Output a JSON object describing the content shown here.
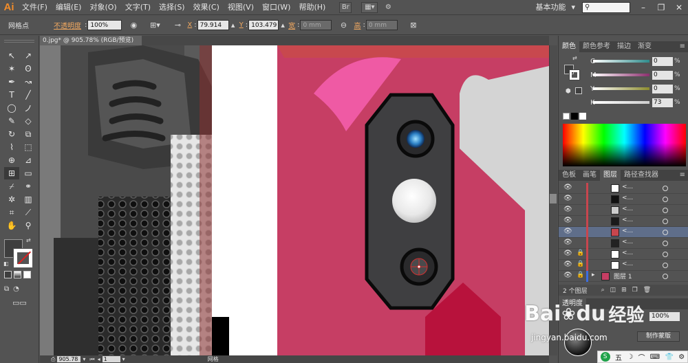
{
  "app": {
    "logo": "Ai"
  },
  "menu": [
    "文件(F)",
    "编辑(E)",
    "对象(O)",
    "文字(T)",
    "选择(S)",
    "效果(C)",
    "视图(V)",
    "窗口(W)",
    "帮助(H)"
  ],
  "menubar_buttons": {
    "bridge": "Br",
    "workspace": "基本功能"
  },
  "control": {
    "selection_label": "网格点",
    "opacity_label": "不透明度",
    "opacity_value": "100%",
    "x_label": "X",
    "x_value": "79.914",
    "y_label": "Y",
    "y_value": "103.479",
    "w_label": "宽",
    "w_value": "0 mm",
    "h_label": "高",
    "h_value": "0 mm"
  },
  "document": {
    "tab_title": "0.jpg* @ 905.78% (RGB/预览)"
  },
  "status": {
    "zoom": "905.78",
    "page": "1",
    "tool": "网格"
  },
  "color_panel": {
    "tabs": [
      "颜色",
      "颜色参考",
      "描边",
      "渐变"
    ],
    "channels": [
      {
        "label": "C",
        "value": "0",
        "color": "#2e8c8c"
      },
      {
        "label": "M",
        "value": "0",
        "color": "#8c2e6e"
      },
      {
        "label": "Y",
        "value": "0",
        "color": "#8c8c2e"
      },
      {
        "label": "K",
        "value": "73",
        "color": "#cfcfcf"
      }
    ],
    "percent": "%"
  },
  "layers_panel": {
    "tabs": [
      "色板",
      "画笔",
      "图层",
      "路径查找器"
    ],
    "rows": [
      {
        "name": "<...",
        "locked": false,
        "thumb": "#ffffff",
        "selected": false
      },
      {
        "name": "<...",
        "locked": false,
        "thumb": "#111111",
        "selected": false
      },
      {
        "name": "<...",
        "locked": false,
        "thumb": "#cccccc",
        "selected": false
      },
      {
        "name": "<...",
        "locked": false,
        "thumb": "#1a1a1a",
        "selected": false
      },
      {
        "name": "<...",
        "locked": false,
        "thumb": "#c8464e",
        "selected": true
      },
      {
        "name": "<...",
        "locked": false,
        "thumb": "#222222",
        "selected": false
      },
      {
        "name": "<...",
        "locked": true,
        "thumb": "#ffffff",
        "selected": false
      },
      {
        "name": "<...",
        "locked": true,
        "thumb": "#ffffff",
        "selected": false
      }
    ],
    "group_row": {
      "name": "图层 1"
    },
    "footer_count": "2 个图层"
  },
  "transparency": {
    "tab": "透明度",
    "value": "100%",
    "button": "制作蒙版"
  },
  "watermark": {
    "brand": "Bai",
    "brand2": "du",
    "cn": "经验",
    "url": "jingyan.baidu.com"
  },
  "ime": [
    "五",
    "☽",
    "⌒",
    "⌨",
    "👕",
    "⚙"
  ]
}
